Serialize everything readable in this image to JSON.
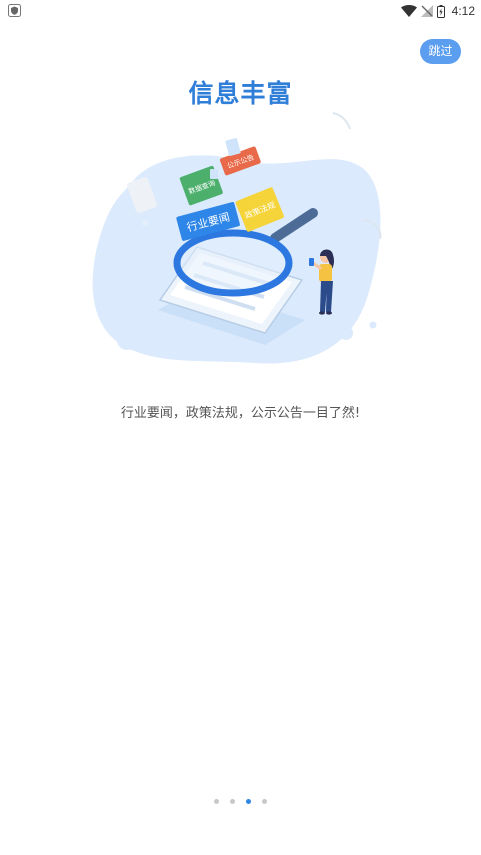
{
  "status_bar": {
    "time": "4:12",
    "left_icon": "shield-icon",
    "icons": [
      "wifi-icon",
      "no-signal-icon",
      "battery-icon"
    ]
  },
  "skip_button": {
    "label": "跳过",
    "color": "#5b9def"
  },
  "title": {
    "text": "信息丰富",
    "color": "#2f7ed8"
  },
  "illustration": {
    "cards": {
      "industry_news": "行业要闻",
      "policy": "政策法规",
      "public_notice": "公示公告",
      "data_query": "数据查询"
    }
  },
  "description": "行业要闻，政策法规，公示公告一目了然!",
  "pager": {
    "total": 4,
    "active_index": 2
  }
}
